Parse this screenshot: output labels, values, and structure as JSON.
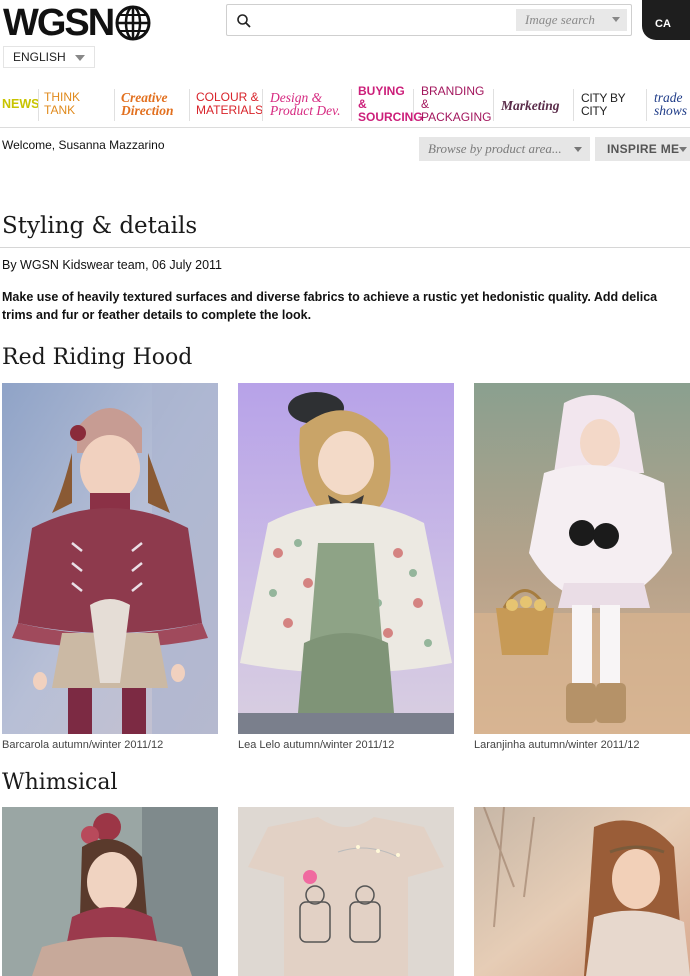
{
  "header": {
    "logo_text": "WGSN",
    "language": "ENGLISH",
    "search_placeholder": "",
    "search_type": "Image search",
    "cart_label": "CA"
  },
  "nav": {
    "items": [
      {
        "line1": "NEWS",
        "line2": "",
        "color": "#c8c400"
      },
      {
        "line1": "THINK TANK",
        "line2": "",
        "color": "#e08a1c"
      },
      {
        "line1": "Creative",
        "line2": "Direction",
        "color": "#e2701f"
      },
      {
        "line1": "COLOUR &",
        "line2": "MATERIALS",
        "color": "#d8232a"
      },
      {
        "line1": "Design &",
        "line2": "Product Dev.",
        "color": "#d62980"
      },
      {
        "line1": "BUYING &",
        "line2": "SOURCING",
        "color": "#cc1f7a"
      },
      {
        "line1": "BRANDING &",
        "line2": "PACKAGING",
        "color": "#a3175e"
      },
      {
        "line1": "Marketing",
        "line2": "",
        "color": "#5a2c4a"
      },
      {
        "line1": "CITY BY CITY",
        "line2": "",
        "color": "#222222"
      },
      {
        "line1": "trade",
        "line2": "shows",
        "color": "#1f3c88"
      }
    ]
  },
  "subheader": {
    "welcome": "Welcome, Susanna Mazzarino",
    "browse": "Browse by product area...",
    "inspire": "INSPIRE ME"
  },
  "article": {
    "title": "Styling & details",
    "byline": "By WGSN Kidswear team, 06 July 2011",
    "intro_line1": "Make use of heavily textured surfaces and diverse fabrics to achieve a rustic yet hedonistic quality. Add delica",
    "intro_line2": "trims and fur or feather details to complete the look.",
    "sections": [
      {
        "heading": "Red Riding Hood",
        "captions": [
          "Barcarola autumn/winter 2011/12",
          "Lea Lelo autumn/winter 2011/12",
          "Laranjinha autumn/winter 2011/12"
        ]
      },
      {
        "heading": "Whimsical",
        "captions": []
      }
    ]
  }
}
